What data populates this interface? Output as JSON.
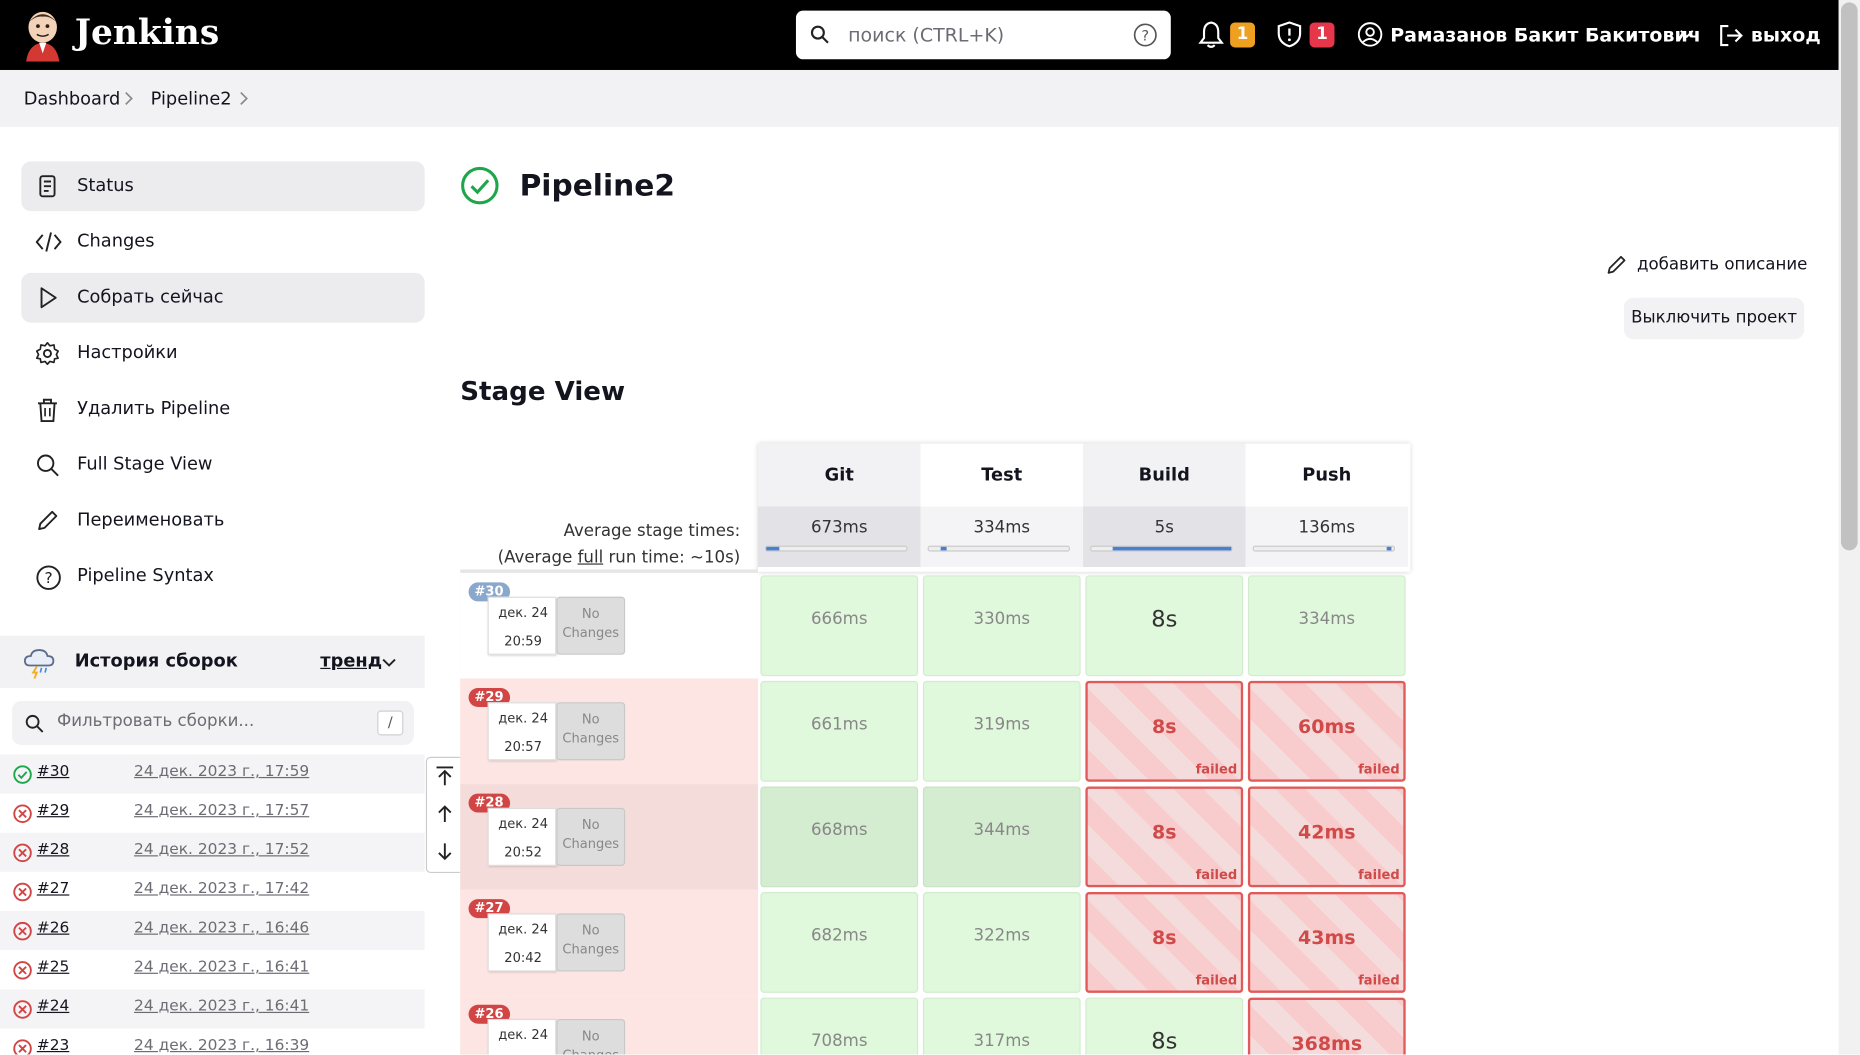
{
  "header": {
    "brand": "Jenkins",
    "search_placeholder": "поиск (CTRL+K)",
    "notifications_count": "1",
    "security_count": "1",
    "user_name": "Рамазанов Бакит Бакитович",
    "logout_label": "выход"
  },
  "breadcrumbs": [
    "Dashboard",
    "Pipeline2"
  ],
  "sidebar": {
    "items": [
      {
        "label": "Status",
        "icon": "document-icon"
      },
      {
        "label": "Changes",
        "icon": "code-icon"
      },
      {
        "label": "Собрать сейчас",
        "icon": "play-icon"
      },
      {
        "label": "Настройки",
        "icon": "gear-icon"
      },
      {
        "label": "Удалить Pipeline",
        "icon": "trash-icon"
      },
      {
        "label": "Full Stage View",
        "icon": "search-icon"
      },
      {
        "label": "Переименовать",
        "icon": "pencil-icon"
      },
      {
        "label": "Pipeline Syntax",
        "icon": "help-icon"
      }
    ]
  },
  "history": {
    "title": "История сборок",
    "trend_label": "тренд",
    "filter_placeholder": "Фильтровать сборки...",
    "filter_shortcut": "/",
    "builds": [
      {
        "num": "#30",
        "date": "24 дек. 2023 г., 17:59",
        "status": "success"
      },
      {
        "num": "#29",
        "date": "24 дек. 2023 г., 17:57",
        "status": "failed"
      },
      {
        "num": "#28",
        "date": "24 дек. 2023 г., 17:52",
        "status": "failed"
      },
      {
        "num": "#27",
        "date": "24 дек. 2023 г., 17:42",
        "status": "failed"
      },
      {
        "num": "#26",
        "date": "24 дек. 2023 г., 16:46",
        "status": "failed"
      },
      {
        "num": "#25",
        "date": "24 дек. 2023 г., 16:41",
        "status": "failed"
      },
      {
        "num": "#24",
        "date": "24 дек. 2023 г., 16:41",
        "status": "failed"
      },
      {
        "num": "#23",
        "date": "24 дек. 2023 г., 16:39",
        "status": "failed"
      }
    ]
  },
  "main": {
    "title": "Pipeline2",
    "add_description": "добавить описание",
    "disable_project": "Выключить проект",
    "stage_view_title": "Stage View"
  },
  "stage_view": {
    "stages": [
      "Git",
      "Test",
      "Build",
      "Push"
    ],
    "avg_label_1": "Average stage times:",
    "avg_label_2_pre": "(Average ",
    "avg_label_2_link": "full",
    "avg_label_2_post": " run time: ~10s)",
    "averages": [
      "673ms",
      "334ms",
      "5s",
      "136ms"
    ],
    "avg_fraction": [
      0.09,
      0.04,
      0.85,
      0.02
    ],
    "failed_label": "failed",
    "no_changes": "No Changes",
    "runs": [
      {
        "badge": "#30",
        "date": "дек. 24",
        "time": "20:59",
        "status": "success",
        "cells": [
          "666ms",
          "330ms",
          "8s",
          "334ms"
        ],
        "cell_status": [
          "ok",
          "ok",
          "ok",
          "ok"
        ]
      },
      {
        "badge": "#29",
        "date": "дек. 24",
        "time": "20:57",
        "status": "failed",
        "cells": [
          "661ms",
          "319ms",
          "8s",
          "60ms"
        ],
        "cell_status": [
          "ok",
          "ok",
          "fail",
          "fail"
        ]
      },
      {
        "badge": "#28",
        "date": "дек. 24",
        "time": "20:52",
        "status": "failed",
        "cells": [
          "668ms",
          "344ms",
          "8s",
          "42ms"
        ],
        "cell_status": [
          "ok",
          "ok",
          "fail",
          "fail"
        ]
      },
      {
        "badge": "#27",
        "date": "дек. 24",
        "time": "20:42",
        "status": "failed",
        "cells": [
          "682ms",
          "322ms",
          "8s",
          "43ms"
        ],
        "cell_status": [
          "ok",
          "ok",
          "fail",
          "fail"
        ]
      },
      {
        "badge": "#26",
        "date": "дек. 24",
        "time": "",
        "status": "failed",
        "cells": [
          "708ms",
          "317ms",
          "8s",
          "368ms"
        ],
        "cell_status": [
          "ok",
          "ok",
          "ok",
          "fail"
        ]
      }
    ]
  },
  "colors": {
    "header_bg": "#000000",
    "badge_warn": "#f0a020",
    "badge_danger": "#e5364a",
    "success": "#1ea64b",
    "fail": "#d24545"
  }
}
